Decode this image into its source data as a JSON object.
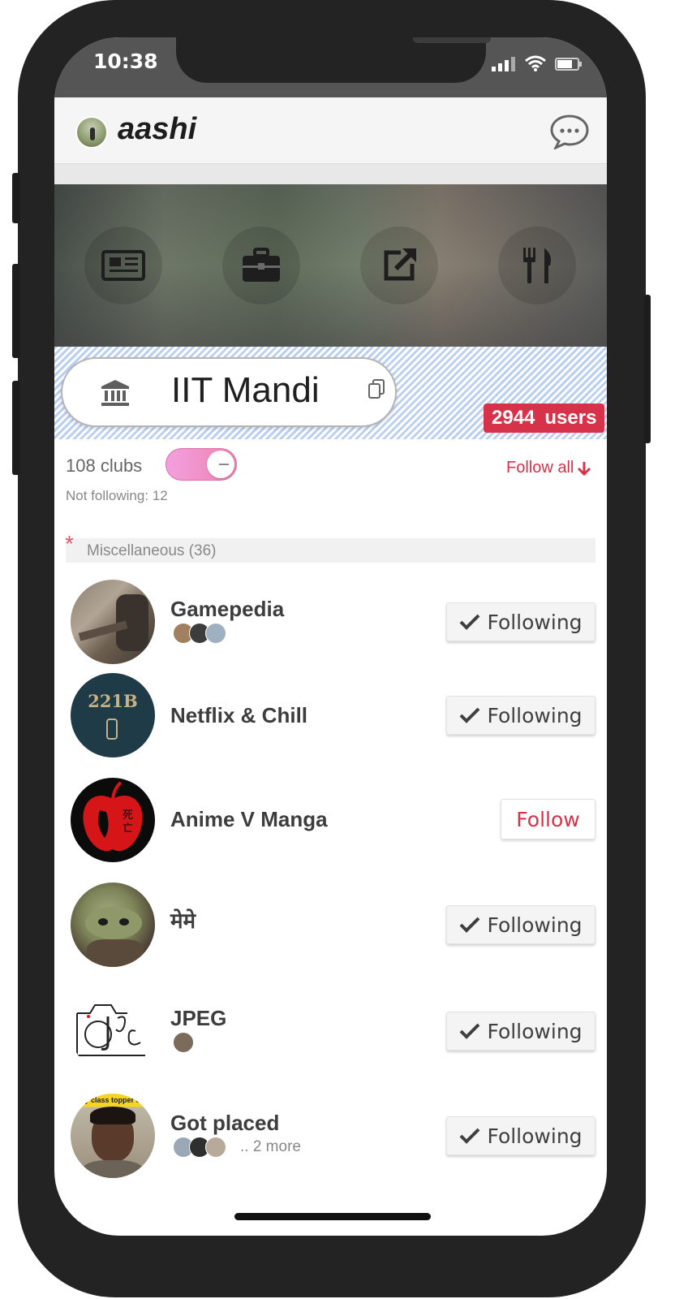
{
  "status_bar": {
    "time": "10:38"
  },
  "header": {
    "brand": "aashi"
  },
  "institution": {
    "name": "IIT Mandi",
    "users_count": "2944",
    "users_label": "users"
  },
  "clubs": {
    "count_label": "108 clubs",
    "not_following_label": "Not following: 12",
    "follow_all_label": "Follow all",
    "show_all_toggle_on": true
  },
  "section": {
    "asterisk": "*",
    "title": "Miscellaneous (36)"
  },
  "club_list": [
    {
      "name": "Gamepedia",
      "button": "Following",
      "state": "following"
    },
    {
      "name": "Netflix & Chill",
      "button": "Following",
      "state": "following"
    },
    {
      "name": "Anime V Manga",
      "button": "Follow",
      "state": "not-following"
    },
    {
      "name": "मेमे",
      "button": "Following",
      "state": "following"
    },
    {
      "name": "JPEG",
      "button": "Following",
      "state": "following"
    },
    {
      "name": "Got placed",
      "button": "Following",
      "state": "following",
      "more": ".. 2 more"
    }
  ],
  "avatar_texts": {
    "netflix": "221B",
    "placed_caption": "ry class topper e"
  },
  "colors": {
    "accent": "#d6334b",
    "toggle": "#f08dc8",
    "stripe": "#bcd0f2"
  },
  "icons": {
    "banner": [
      "newspaper-icon",
      "briefcase-icon",
      "external-link-icon",
      "utensils-icon"
    ],
    "chat": "chat-bubble-icon",
    "institution": "bank-icon",
    "copy": "copy-icon"
  }
}
